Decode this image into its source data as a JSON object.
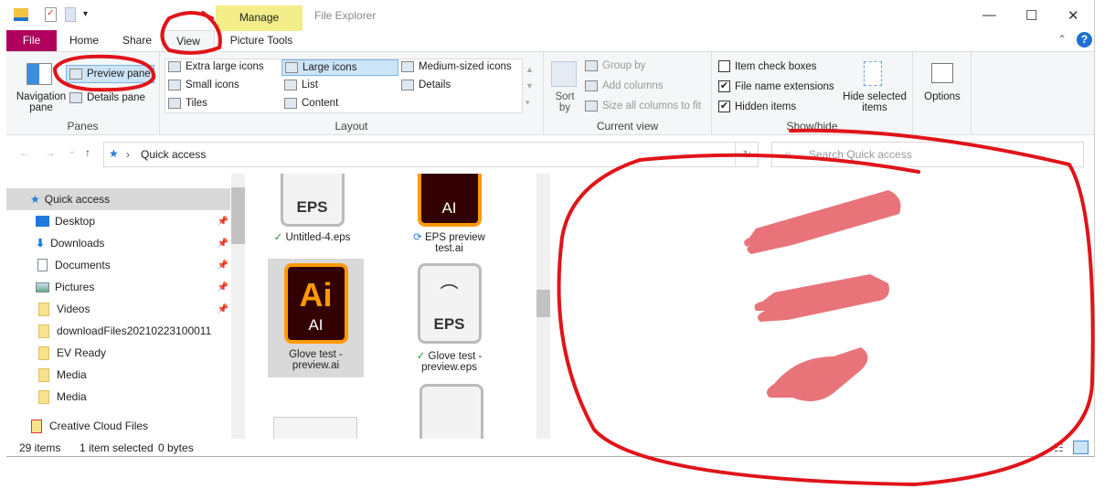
{
  "window": {
    "title": "File Explorer",
    "context_tab": "Manage",
    "minimize": "—",
    "maximize": "☐",
    "close": "✕"
  },
  "tabs": {
    "file": "File",
    "home": "Home",
    "share": "Share",
    "view": "View",
    "picture_tools": "Picture Tools"
  },
  "ribbon": {
    "panes": {
      "label": "Panes",
      "navigation_pane": "Navigation pane",
      "preview_pane": "Preview pane",
      "details_pane": "Details pane"
    },
    "layout": {
      "label": "Layout",
      "items": [
        "Extra large icons",
        "Large icons",
        "Medium-sized icons",
        "Small icons",
        "List",
        "Details",
        "Tiles",
        "Content"
      ],
      "selected": "Large icons"
    },
    "current_view": {
      "label": "Current view",
      "sort_by": "Sort by",
      "group_by": "Group by",
      "add_columns": "Add columns",
      "size_columns": "Size all columns to fit"
    },
    "show_hide": {
      "label": "Show/hide",
      "item_check_boxes": "Item check boxes",
      "file_name_extensions": "File name extensions",
      "hidden_items": "Hidden items",
      "hide_selected": "Hide selected items",
      "checks": {
        "item_check_boxes": false,
        "file_name_extensions": true,
        "hidden_items": true
      }
    },
    "options": "Options"
  },
  "address": {
    "path": "Quick access",
    "search_placeholder": "Search Quick access"
  },
  "nav": {
    "items": [
      {
        "label": "Quick access",
        "pinned": false
      },
      {
        "label": "Desktop",
        "pinned": true
      },
      {
        "label": "Downloads",
        "pinned": true
      },
      {
        "label": "Documents",
        "pinned": true
      },
      {
        "label": "Pictures",
        "pinned": true
      },
      {
        "label": "Videos",
        "pinned": true
      },
      {
        "label": "downloadFiles20210223100011",
        "pinned": false
      },
      {
        "label": "EV Ready",
        "pinned": false
      },
      {
        "label": "Media",
        "pinned": false
      },
      {
        "label": "Media",
        "pinned": false
      },
      {
        "label": "Creative Cloud Files",
        "pinned": false
      }
    ]
  },
  "files": [
    {
      "name": "Untitled-4.eps",
      "type": "EPS",
      "status": "✓"
    },
    {
      "name": "EPS preview test.ai",
      "type": "AI",
      "status": "⟳"
    },
    {
      "name": "Glove test - preview.ai",
      "type": "AI",
      "logo": "Ai",
      "status": ""
    },
    {
      "name": "Glove test - preview.eps",
      "type": "EPS",
      "status": "✓"
    }
  ],
  "status": {
    "count": "29 items",
    "selected": "1 item selected",
    "size": "0 bytes"
  },
  "colors": {
    "file_tab": "#b0005e",
    "manage": "#f3ee8a",
    "selection": "#cce4f7",
    "annotation": "#e0141a",
    "ai_bg": "#330000",
    "ai_orange": "#ff9a00",
    "glove": "#e8747a"
  }
}
